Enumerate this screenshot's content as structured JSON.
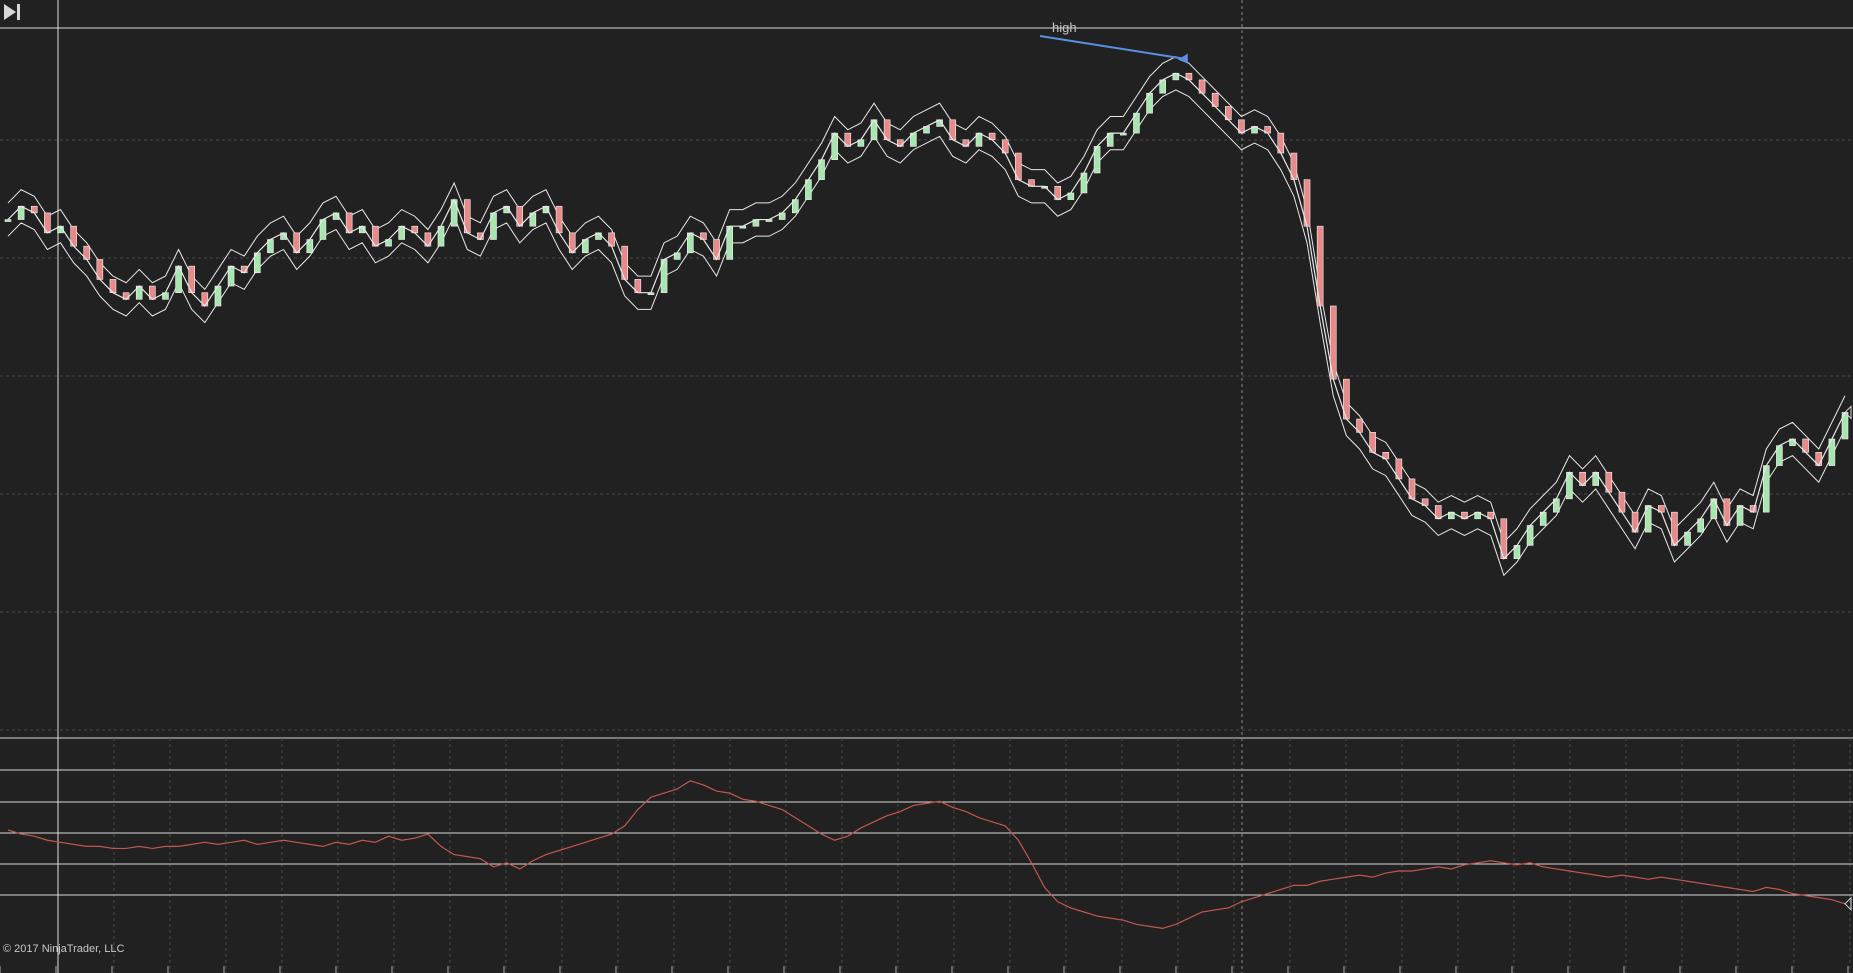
{
  "app": {
    "copyright": "© 2017 NinjaTrader, LLC"
  },
  "colors": {
    "background": "#212121",
    "grid": "#4a4a4a",
    "price_line": "#e8e8e8",
    "candle_up": "#a8e6b0",
    "candle_down": "#e88a8a",
    "indicator": "#c0584f",
    "annotation_arrow": "#5b8fe0",
    "hline": "#d8d8d8"
  },
  "navigation": {
    "scroll_to_end_icon": "skip-to-end-icon"
  },
  "chart_data": [
    {
      "type": "line",
      "panel": "price",
      "title": "",
      "xlabel": "",
      "ylabel": "",
      "grid": true,
      "ylim": [
        0,
        100
      ],
      "x": [
        0,
        1,
        2,
        3,
        4,
        5,
        6,
        7,
        8,
        9,
        10,
        11,
        12,
        13,
        14,
        15,
        16,
        17,
        18,
        19,
        20,
        21,
        22,
        23,
        24,
        25,
        26,
        27,
        28,
        29,
        30,
        31,
        32,
        33,
        34,
        35,
        36,
        37,
        38,
        39,
        40,
        41,
        42,
        43,
        44,
        45,
        46,
        47,
        48,
        49,
        50,
        51,
        52,
        53,
        54,
        55,
        56,
        57,
        58,
        59,
        60,
        61,
        62,
        63,
        64,
        65,
        66,
        67,
        68,
        69,
        70,
        71,
        72,
        73,
        74,
        75,
        76,
        77,
        78,
        79,
        80,
        81,
        82,
        83,
        84,
        85,
        86,
        87,
        88,
        89,
        90,
        91,
        92,
        93,
        94,
        95,
        96,
        97,
        98,
        99,
        100,
        101,
        102,
        103,
        104,
        105,
        106,
        107,
        108,
        109,
        110,
        111,
        112,
        113,
        114,
        115,
        116,
        117,
        118,
        119,
        120,
        121,
        122,
        123,
        124,
        125,
        126,
        127,
        128,
        129,
        130,
        131,
        132,
        133,
        134,
        135,
        136,
        137,
        138,
        139,
        140
      ],
      "series": [
        {
          "values": [
            73,
            75,
            74,
            71,
            72,
            69,
            67,
            64,
            62,
            61,
            63,
            61,
            62,
            66,
            62,
            60,
            63,
            66,
            65,
            68,
            70,
            71,
            68,
            70,
            73,
            74,
            71,
            72,
            69,
            70,
            72,
            71,
            69,
            72,
            76,
            71,
            70,
            74,
            75,
            72,
            74,
            75,
            71,
            68,
            70,
            71,
            69,
            64,
            62,
            62,
            67,
            68,
            71,
            70,
            67,
            72,
            72,
            73,
            73,
            74,
            76,
            79,
            82,
            86,
            84,
            85,
            88,
            85,
            84,
            86,
            87,
            88,
            85,
            84,
            86,
            85,
            83,
            79,
            78,
            78,
            76,
            77,
            80,
            84,
            86,
            86,
            89,
            92,
            94,
            95,
            94,
            92,
            90,
            88,
            86,
            87,
            86,
            83,
            79,
            72,
            60,
            49,
            43,
            41,
            38,
            37,
            34,
            31,
            30,
            28,
            29,
            28,
            29,
            28,
            22,
            24,
            27,
            29,
            31,
            35,
            33,
            35,
            32,
            29,
            26,
            30,
            29,
            24,
            26,
            28,
            31,
            27,
            30,
            29,
            36,
            39,
            40,
            38,
            36,
            40,
            44
          ]
        }
      ],
      "annotations": [
        {
          "text": "high"
        }
      ]
    },
    {
      "type": "line",
      "panel": "indicator",
      "title": "",
      "grid": true,
      "ylim": [
        0,
        100
      ],
      "series": [
        {
          "values": [
            60,
            58,
            57,
            55,
            54,
            53,
            52,
            52,
            51,
            51,
            52,
            51,
            52,
            52,
            53,
            54,
            53,
            54,
            55,
            53,
            54,
            55,
            54,
            53,
            52,
            54,
            53,
            55,
            54,
            57,
            55,
            56,
            58,
            52,
            48,
            47,
            46,
            42,
            44,
            41,
            45,
            48,
            50,
            52,
            54,
            56,
            58,
            62,
            70,
            76,
            78,
            80,
            84,
            82,
            79,
            78,
            75,
            74,
            72,
            70,
            66,
            62,
            58,
            55,
            57,
            61,
            64,
            67,
            69,
            72,
            73,
            74,
            71,
            69,
            66,
            64,
            62,
            55,
            44,
            32,
            25,
            22,
            20,
            18,
            17,
            16,
            14,
            13,
            12,
            14,
            17,
            20,
            21,
            22,
            25,
            27,
            29,
            31,
            33,
            33,
            35,
            36,
            37,
            38,
            37,
            39,
            40,
            40,
            41,
            42,
            41,
            43,
            44,
            45,
            44,
            43,
            44,
            42,
            41,
            40,
            39,
            38,
            37,
            38,
            37,
            36,
            37,
            36,
            35,
            34,
            33,
            32,
            31,
            30,
            32,
            31,
            29,
            28,
            27,
            26,
            24
          ]
        }
      ]
    }
  ]
}
